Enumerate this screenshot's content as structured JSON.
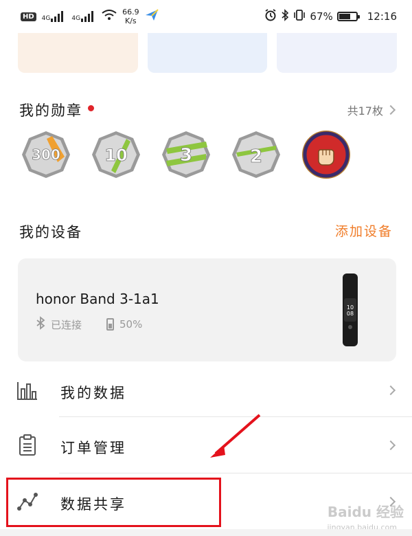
{
  "status_bar": {
    "hd": "HD",
    "net1": "4G",
    "net2": "4G",
    "speed_value": "66.9",
    "speed_unit": "K/s",
    "battery_pct": "67%",
    "time": "12:16"
  },
  "medals": {
    "title": "我的勋章",
    "count_label": "共17枚",
    "items": [
      {
        "label": "300",
        "accent": "#f0a030"
      },
      {
        "label": "10",
        "accent": "#8ec63f"
      },
      {
        "label": "3",
        "accent": "#8ec63f"
      },
      {
        "label": "2",
        "accent": "#8ec63f"
      },
      {
        "label": "",
        "accent": "#d02a2a"
      }
    ]
  },
  "devices": {
    "title": "我的设备",
    "add_label": "添加设备",
    "card": {
      "name": "honor Band 3-1a1",
      "connection": "已连接",
      "battery": "50%"
    }
  },
  "menu": [
    {
      "label": "我的数据",
      "icon": "bar-chart-icon"
    },
    {
      "label": "订单管理",
      "icon": "clipboard-icon"
    },
    {
      "label": "数据共享",
      "icon": "share-graph-icon"
    }
  ],
  "watermark": {
    "brand": "Baidu 经验",
    "url": "jingyan.baidu.com"
  },
  "colors": {
    "accent_orange": "#f07d2a",
    "highlight_red": "#e4121c",
    "dot_red": "#e0242a"
  }
}
